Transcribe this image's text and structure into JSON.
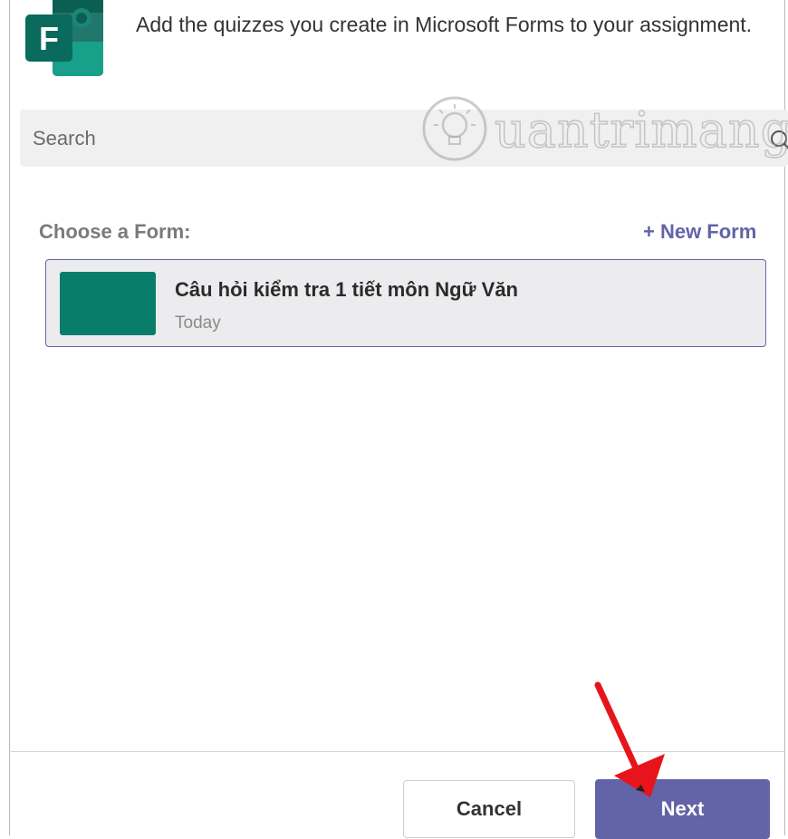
{
  "header": {
    "description": "Add the quizzes you create in Microsoft Forms to your assignment.",
    "app_icon": "microsoft-forms-icon",
    "app_icon_letter": "F"
  },
  "search": {
    "placeholder": "Search",
    "icon": "search-icon"
  },
  "watermark": {
    "text": "uantrimang"
  },
  "forms_section": {
    "label": "Choose a Form:",
    "new_form_label": "+ New Form",
    "items": [
      {
        "title": "Câu hỏi kiểm tra 1 tiết môn Ngữ Văn",
        "date": "Today"
      }
    ]
  },
  "footer": {
    "cancel_label": "Cancel",
    "next_label": "Next"
  },
  "colors": {
    "accent": "#6264a7",
    "forms_green": "#077d6a",
    "annotation_arrow": "#e8141b"
  }
}
